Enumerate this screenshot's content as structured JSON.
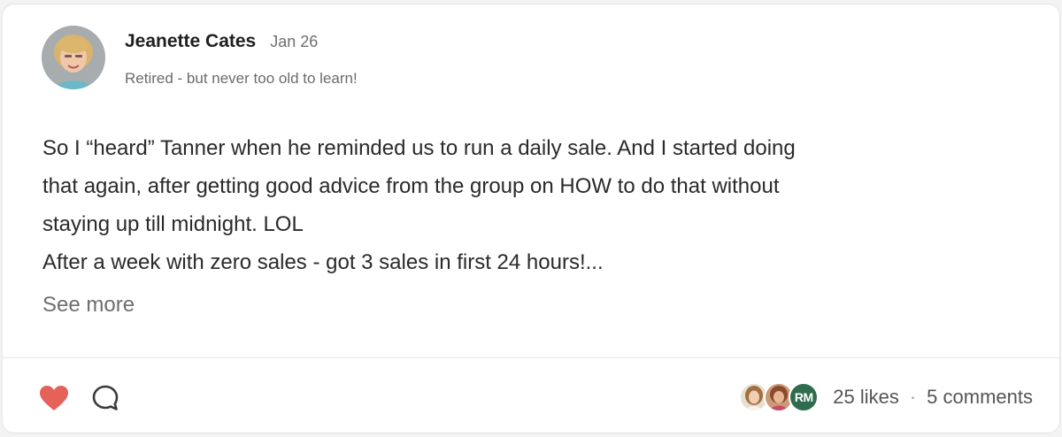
{
  "post": {
    "author": {
      "name": "Jeanette Cates",
      "date": "Jan 26",
      "tagline": "Retired - but never too old to learn!"
    },
    "body_lines": [
      "So I “heard” Tanner when he reminded us to run a daily sale. And I started doing",
      "that again, after getting good advice from the group on HOW to do that without",
      "staying up till midnight. LOL",
      "After a week with zero sales - got 3 sales in first 24 hours!..."
    ],
    "see_more": "See more",
    "footer": {
      "like_icon": "heart-icon",
      "comment_icon": "comment-bubble-icon",
      "reactor_initials": "RM",
      "likes_text": "25 likes",
      "separator": "·",
      "comments_text": "5 comments"
    },
    "colors": {
      "heart": "#e5625a",
      "initials_bg": "#2f6b4f"
    }
  }
}
